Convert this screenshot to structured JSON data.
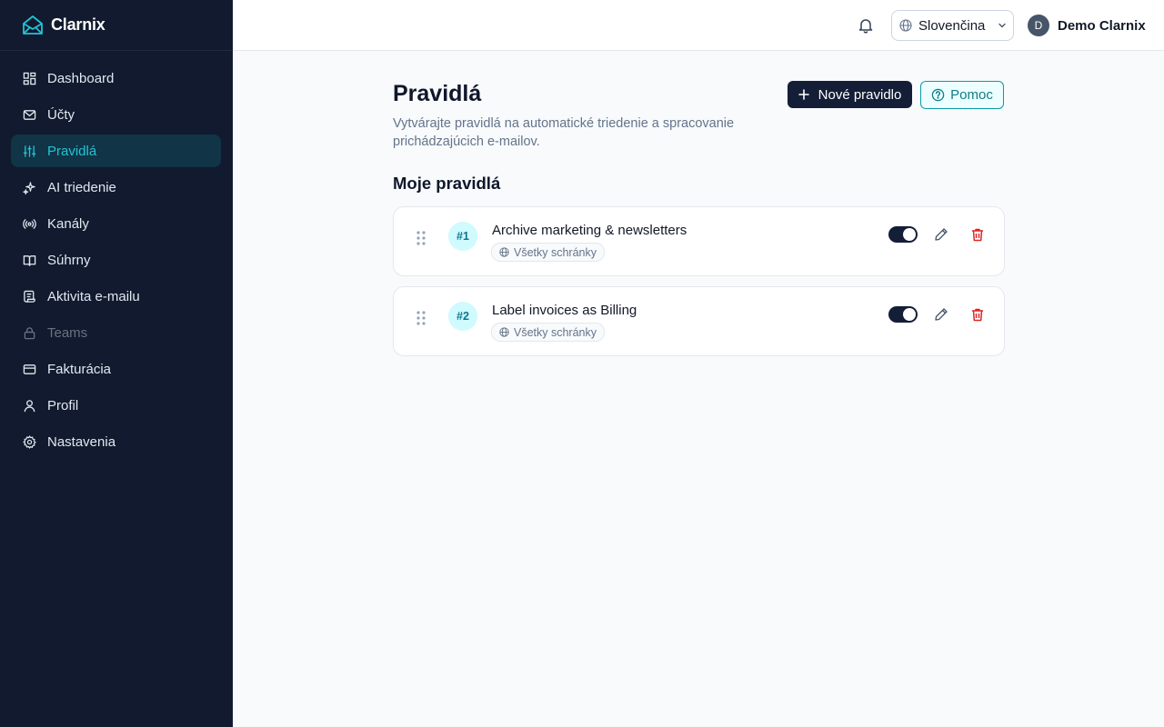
{
  "app": {
    "name": "Clarnix"
  },
  "sidebar": {
    "items": [
      {
        "label": "Dashboard",
        "icon": "dashboard-icon"
      },
      {
        "label": "Účty",
        "icon": "mail-icon"
      },
      {
        "label": "Pravidlá",
        "icon": "sliders-icon",
        "active": true
      },
      {
        "label": "AI triedenie",
        "icon": "sparkles-icon"
      },
      {
        "label": "Kanály",
        "icon": "radio-icon"
      },
      {
        "label": "Súhrny",
        "icon": "book-icon"
      },
      {
        "label": "Aktivita e-mailu",
        "icon": "scroll-icon"
      },
      {
        "label": "Teams",
        "icon": "lock-icon",
        "disabled": true
      },
      {
        "label": "Fakturácia",
        "icon": "credit-card-icon"
      },
      {
        "label": "Profil",
        "icon": "user-icon"
      },
      {
        "label": "Nastavenia",
        "icon": "gear-icon"
      }
    ]
  },
  "header": {
    "language": "Slovenčina",
    "user_initial": "D",
    "user_name": "Demo Clarnix"
  },
  "main": {
    "title": "Pravidlá",
    "subtitle": "Vytvárajte pravidlá na automatické triedenie a spracovanie prichádzajúcich e-mailov.",
    "new_button": "Nové pravidlo",
    "help_button": "Pomoc",
    "section_title": "Moje pravidlá",
    "rules": [
      {
        "number": "#1",
        "name": "Archive marketing & newsletters",
        "scope": "Všetky schránky",
        "enabled": true
      },
      {
        "number": "#2",
        "name": "Label invoices as Billing",
        "scope": "Všetky schránky",
        "enabled": true
      }
    ]
  },
  "colors": {
    "sidebar_bg": "#111a2e",
    "accent": "#22c3d6",
    "primary_button": "#141e37",
    "danger": "#dc2626"
  }
}
